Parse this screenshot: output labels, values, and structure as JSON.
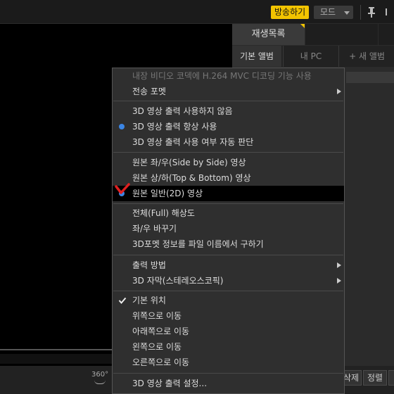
{
  "header": {
    "broadcast_label": "방송하기",
    "mode_label": "모드"
  },
  "panel": {
    "tab_playlist": "재생목록",
    "subtabs": [
      "기본 앨범",
      "내 PC",
      "+ 새 앨범"
    ]
  },
  "bottom": {
    "vr_label": "360°",
    "delete_label": "삭제",
    "sort_label": "정렬"
  },
  "menu": {
    "items": [
      {
        "label": "내장 비디오 코덱에 H.264 MVC 디코딩 기능 사용",
        "state": "disabled"
      },
      {
        "label": "전송 포멧",
        "submenu": true
      },
      {
        "label": "3D 영상 출력 사용하지 않음"
      },
      {
        "label": "3D 영상 출력 항상 사용",
        "state": "radio-selected"
      },
      {
        "label": "3D 영상 출력 사용 여부 자동 판단"
      },
      {
        "label": "원본 좌/우(Side by Side) 영상"
      },
      {
        "label": "원본 상/하(Top & Bottom) 영상"
      },
      {
        "label": "원본 일반(2D) 영상",
        "state": "highlighted-radio"
      },
      {
        "label": "전체(Full) 해상도"
      },
      {
        "label": "좌/우 바꾸기"
      },
      {
        "label": "3D포멧 정보를 파일 이름에서 구하기"
      },
      {
        "label": "출력 방법",
        "submenu": true
      },
      {
        "label": "3D 자막(스테레오스코픽)",
        "submenu": true
      },
      {
        "label": "기본 위치",
        "state": "checked"
      },
      {
        "label": "위쪽으로 이동"
      },
      {
        "label": "아래쪽으로 이동"
      },
      {
        "label": "왼쪽으로 이동"
      },
      {
        "label": "오른쪽으로 이동"
      },
      {
        "label": "3D 영상 출력 설정..."
      }
    ]
  },
  "colors": {
    "accent_yellow": "#f2c400",
    "radio_blue": "#3b86e5",
    "annotation_red": "#e02020"
  }
}
